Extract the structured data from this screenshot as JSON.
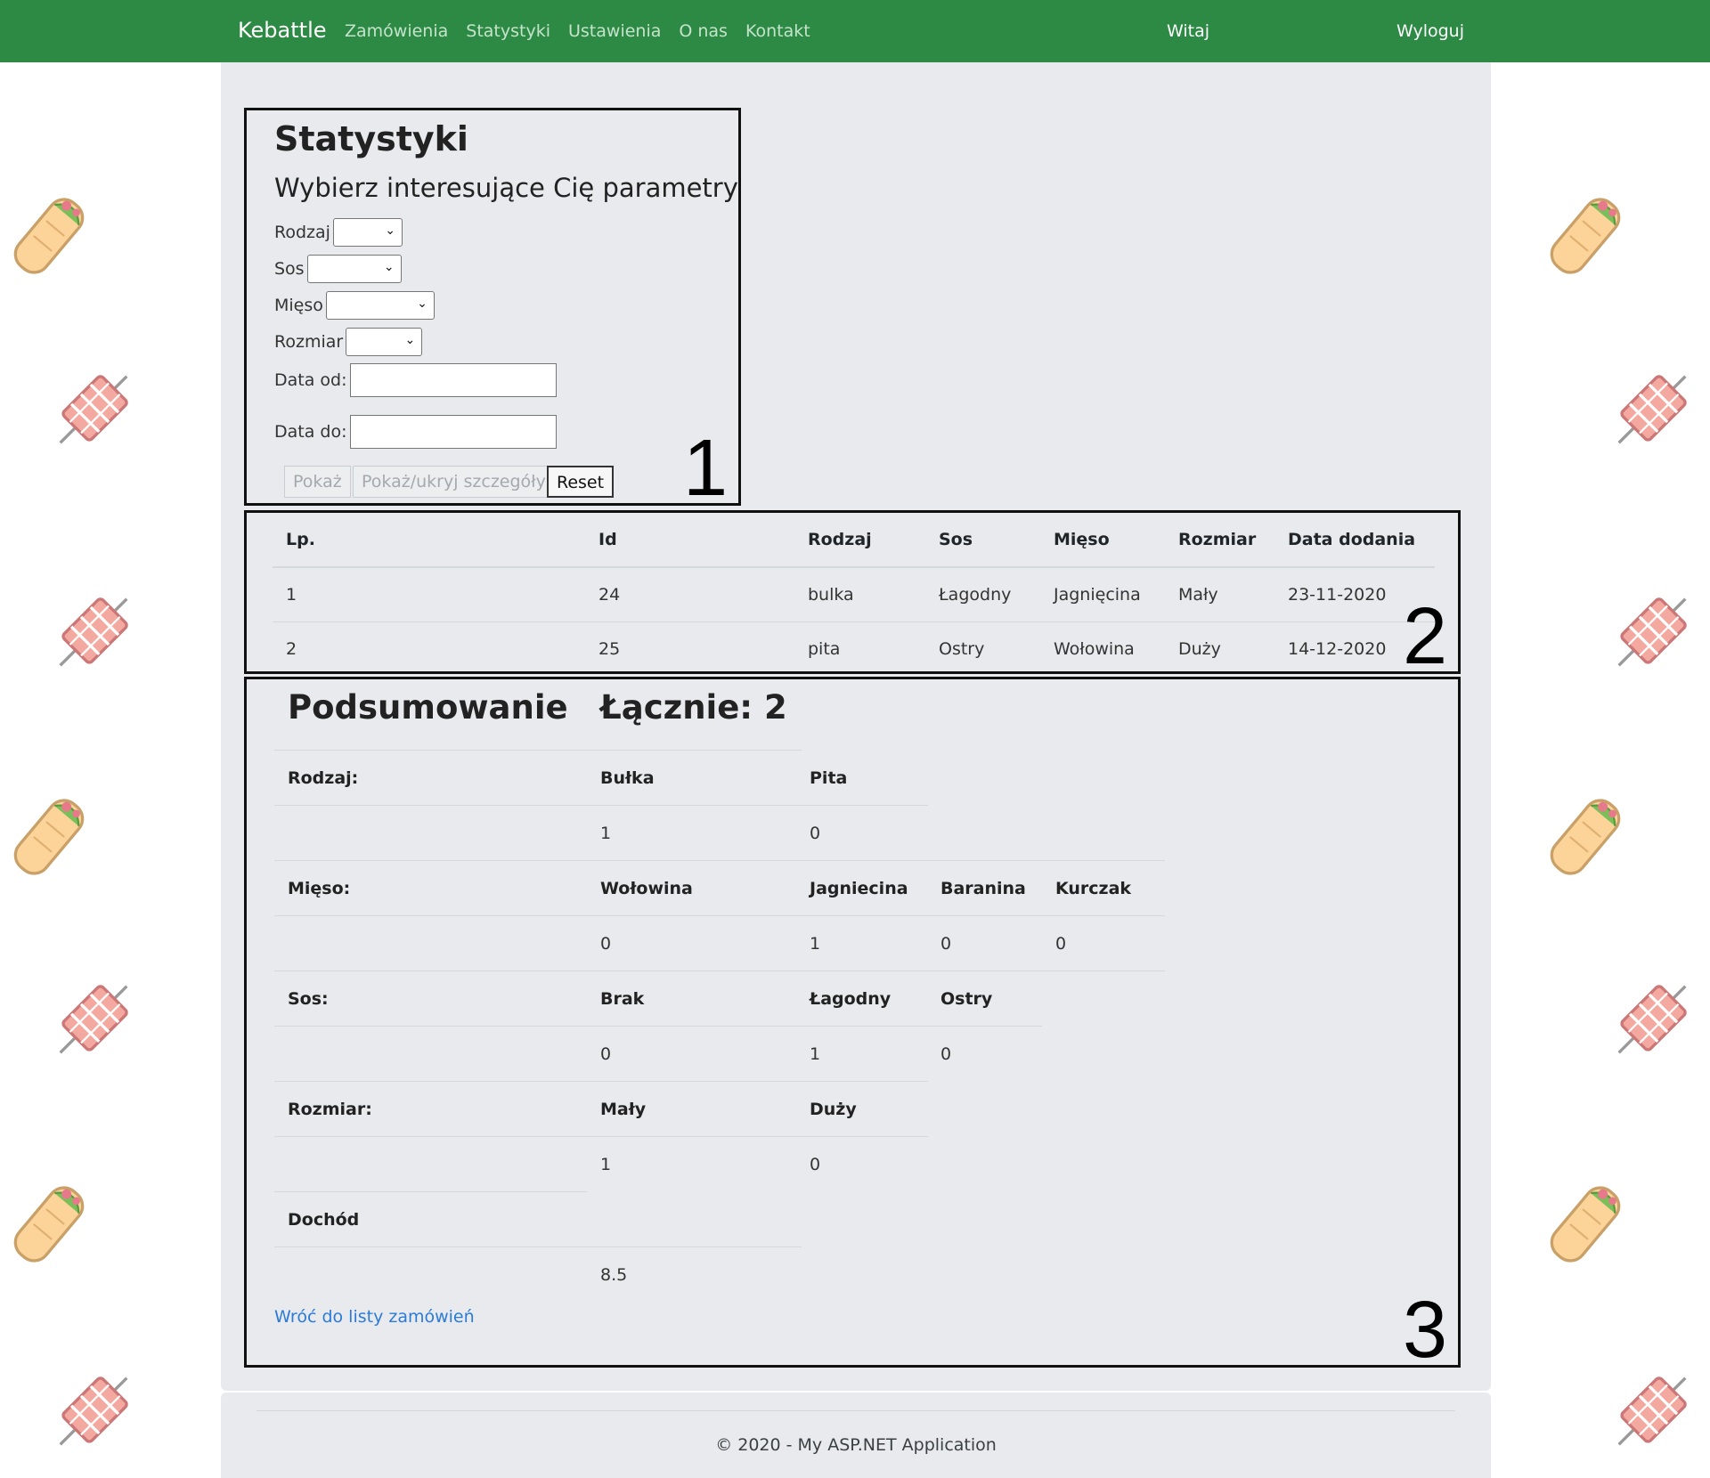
{
  "navbar": {
    "brand": "Kebattle",
    "links": [
      "Zamówienia",
      "Statystyki",
      "Ustawienia",
      "O nas",
      "Kontakt"
    ],
    "greeting": "Witaj",
    "logout": "Wyloguj"
  },
  "filters": {
    "title": "Statystyki",
    "subtitle": "Wybierz interesujące Cię parametry",
    "labels": {
      "type": "Rodzaj",
      "sauce": "Sos",
      "meat": "Mięso",
      "size": "Rozmiar",
      "date_from": "Data od:",
      "date_to": "Data do:"
    },
    "buttons": {
      "show": "Pokaż",
      "toggle_details": "Pokaż/ukryj szczegóły",
      "reset": "Reset"
    },
    "box_number": "1"
  },
  "results": {
    "columns": [
      "Lp.",
      "Id",
      "Rodzaj",
      "Sos",
      "Mięso",
      "Rozmiar",
      "Data dodania"
    ],
    "rows": [
      [
        "1",
        "24",
        "bulka",
        "Łagodny",
        "Jagnięcina",
        "Mały",
        "23-11-2020"
      ],
      [
        "2",
        "25",
        "pita",
        "Ostry",
        "Wołowina",
        "Duży",
        "14-12-2020"
      ]
    ],
    "box_number": "2"
  },
  "summary": {
    "title": "Podsumowanie",
    "total": "Łącznie: 2",
    "groups": [
      {
        "label": "Rodzaj:",
        "headers": [
          "Bułka",
          "Pita"
        ],
        "values": [
          "1",
          "0"
        ]
      },
      {
        "label": "Mięso:",
        "headers": [
          "Wołowina",
          "Jagniecina",
          "Baranina",
          "Kurczak"
        ],
        "values": [
          "0",
          "1",
          "0",
          "0"
        ]
      },
      {
        "label": "Sos:",
        "headers": [
          "Brak",
          "Łagodny",
          "Ostry"
        ],
        "values": [
          "0",
          "1",
          "0"
        ]
      },
      {
        "label": "Rozmiar:",
        "headers": [
          "Mały",
          "Duży"
        ],
        "values": [
          "1",
          "0"
        ]
      },
      {
        "label": "Dochód",
        "headers": [],
        "values": [
          "8.5"
        ]
      }
    ],
    "back_link": "Wróć do listy zamówień",
    "box_number": "3"
  },
  "footer": {
    "text": "© 2020 - My ASP.NET Application"
  },
  "colors": {
    "navbar": "#2d8a44",
    "panel": "#e8eaed",
    "link": "#2b7bd8"
  }
}
